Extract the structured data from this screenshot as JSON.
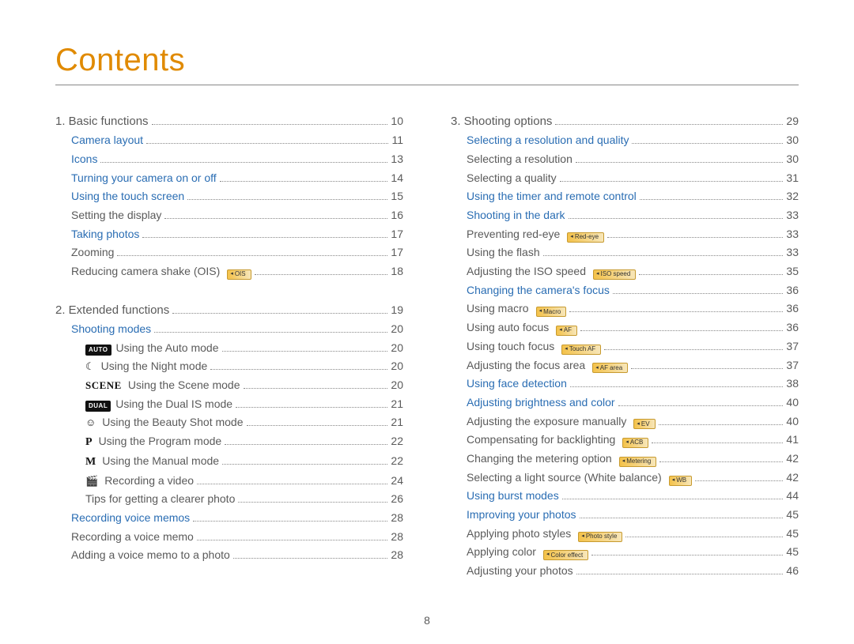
{
  "title": "Contents",
  "page_number": "8",
  "left": [
    {
      "kind": "chapter",
      "label": "1. Basic functions",
      "page": "10"
    },
    {
      "kind": "link",
      "indent": 1,
      "label": "Camera layout",
      "page": "11"
    },
    {
      "kind": "link",
      "indent": 1,
      "label": "Icons",
      "page": "13"
    },
    {
      "kind": "link",
      "indent": 1,
      "label": "Turning your camera on or off",
      "page": "14"
    },
    {
      "kind": "link",
      "indent": 1,
      "label": "Using the touch screen",
      "page": "15"
    },
    {
      "kind": "plain",
      "indent": 1,
      "label": "Setting the display",
      "page": "16"
    },
    {
      "kind": "link",
      "indent": 1,
      "label": "Taking photos",
      "page": "17"
    },
    {
      "kind": "plain",
      "indent": 1,
      "label": "Zooming",
      "page": "17"
    },
    {
      "kind": "plain",
      "indent": 1,
      "label": "Reducing camera shake (OIS)",
      "badge": "OIS",
      "page": "18",
      "gap": true
    },
    {
      "kind": "chapter",
      "label": "2. Extended functions",
      "page": "19"
    },
    {
      "kind": "link",
      "indent": 1,
      "label": "Shooting modes",
      "page": "20"
    },
    {
      "kind": "mode",
      "indent": 2,
      "mode": "auto",
      "label": "Using the Auto mode",
      "page": "20"
    },
    {
      "kind": "mode",
      "indent": 2,
      "mode": "night",
      "label": "Using the Night mode",
      "page": "20"
    },
    {
      "kind": "mode",
      "indent": 2,
      "mode": "scene",
      "label": "Using the Scene mode",
      "page": "20"
    },
    {
      "kind": "mode",
      "indent": 2,
      "mode": "dual",
      "label": "Using the Dual IS mode",
      "page": "21"
    },
    {
      "kind": "mode",
      "indent": 2,
      "mode": "beauty",
      "label": "Using the Beauty Shot mode",
      "page": "21"
    },
    {
      "kind": "mode",
      "indent": 2,
      "mode": "p",
      "label": "Using the Program mode",
      "page": "22"
    },
    {
      "kind": "mode",
      "indent": 2,
      "mode": "m",
      "label": "Using the Manual mode",
      "page": "22"
    },
    {
      "kind": "mode",
      "indent": 2,
      "mode": "video",
      "label": "Recording a video",
      "page": "24"
    },
    {
      "kind": "plain",
      "indent": 2,
      "label": "Tips for getting a clearer photo",
      "page": "26"
    },
    {
      "kind": "link",
      "indent": 1,
      "label": "Recording voice memos",
      "page": "28"
    },
    {
      "kind": "plain",
      "indent": 1,
      "label": "Recording a voice memo",
      "page": "28"
    },
    {
      "kind": "plain",
      "indent": 1,
      "label": "Adding a voice memo to a photo",
      "page": "28"
    }
  ],
  "right": [
    {
      "kind": "chapter",
      "label": "3. Shooting options",
      "page": "29"
    },
    {
      "kind": "link",
      "indent": 1,
      "label": "Selecting a resolution and quality",
      "page": "30"
    },
    {
      "kind": "plain",
      "indent": 1,
      "label": "Selecting a resolution",
      "page": "30"
    },
    {
      "kind": "plain",
      "indent": 1,
      "label": "Selecting a quality",
      "page": "31"
    },
    {
      "kind": "link",
      "indent": 1,
      "label": "Using the timer and remote control",
      "page": "32"
    },
    {
      "kind": "link",
      "indent": 1,
      "label": "Shooting in the dark",
      "page": "33"
    },
    {
      "kind": "plain",
      "indent": 1,
      "label": "Preventing red-eye",
      "badge": "Red-eye",
      "page": "33"
    },
    {
      "kind": "plain",
      "indent": 1,
      "label": "Using the flash",
      "page": "33"
    },
    {
      "kind": "plain",
      "indent": 1,
      "label": "Adjusting the ISO speed",
      "badge": "ISO speed",
      "page": "35"
    },
    {
      "kind": "link",
      "indent": 1,
      "label": "Changing the camera's focus",
      "page": "36"
    },
    {
      "kind": "plain",
      "indent": 1,
      "label": "Using macro",
      "badge": "Macro",
      "page": "36"
    },
    {
      "kind": "plain",
      "indent": 1,
      "label": "Using auto focus",
      "badge": "AF",
      "page": "36"
    },
    {
      "kind": "plain",
      "indent": 1,
      "label": "Using touch focus",
      "badge": "Touch AF",
      "page": "37"
    },
    {
      "kind": "plain",
      "indent": 1,
      "label": "Adjusting the focus area",
      "badge": "AF area",
      "page": "37"
    },
    {
      "kind": "link",
      "indent": 1,
      "label": "Using face detection",
      "page": "38"
    },
    {
      "kind": "link",
      "indent": 1,
      "label": "Adjusting brightness and color",
      "page": "40"
    },
    {
      "kind": "plain",
      "indent": 1,
      "label": "Adjusting the exposure manually",
      "badge": "EV",
      "page": "40"
    },
    {
      "kind": "plain",
      "indent": 1,
      "label": "Compensating for backlighting",
      "badge": "ACB",
      "page": "41"
    },
    {
      "kind": "plain",
      "indent": 1,
      "label": "Changing the metering option",
      "badge": "Metering",
      "page": "42"
    },
    {
      "kind": "plain",
      "indent": 1,
      "label": "Selecting a light source (White balance)",
      "badge": "WB",
      "page": "42"
    },
    {
      "kind": "link",
      "indent": 1,
      "label": "Using burst modes",
      "page": "44"
    },
    {
      "kind": "link",
      "indent": 1,
      "label": "Improving your photos",
      "page": "45"
    },
    {
      "kind": "plain",
      "indent": 1,
      "label": "Applying photo styles",
      "badge": "Photo style",
      "page": "45"
    },
    {
      "kind": "plain",
      "indent": 1,
      "label": "Applying color",
      "badge": "Color effect",
      "page": "45"
    },
    {
      "kind": "plain",
      "indent": 1,
      "label": "Adjusting your photos",
      "page": "46"
    }
  ],
  "mode_icons": {
    "auto": {
      "type": "box",
      "text": "AUTO"
    },
    "dual": {
      "type": "box",
      "text": "DUAL"
    },
    "scene": {
      "type": "scene",
      "text": "SCENE"
    },
    "p": {
      "type": "letter",
      "text": "P"
    },
    "m": {
      "type": "letter",
      "text": "M"
    },
    "night": {
      "type": "glyph",
      "text": "☾"
    },
    "beauty": {
      "type": "glyph",
      "text": "☺"
    },
    "video": {
      "type": "glyph",
      "text": "🎬"
    }
  }
}
